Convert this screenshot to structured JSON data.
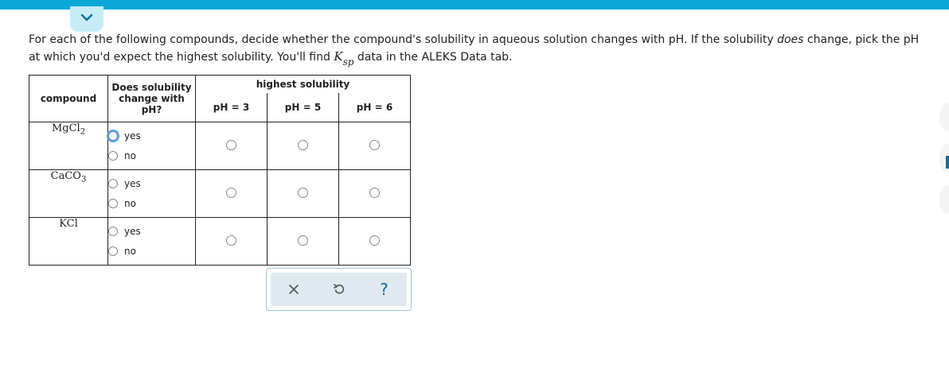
{
  "instructions": {
    "part1": "For each of the following compounds, decide whether the compound's solubility in aqueous solution changes with pH. If the solubility ",
    "emphasis": "does",
    "part2": " change, pick the pH at which you'd expect the highest solubility. You'll find ",
    "ksp_main": "K",
    "ksp_sub": "sp",
    "part3": " data in the ALEKS Data tab."
  },
  "table": {
    "header_compound": "compound",
    "header_change_line1": "Does solubility",
    "header_change_line2": "change with",
    "header_change_line3": "pH?",
    "header_highest": "highest solubility",
    "ph_columns": [
      "pH = 3",
      "pH = 5",
      "pH = 6"
    ],
    "rows": [
      {
        "formula_main": "MgCl",
        "formula_sub": "2",
        "yes": "yes",
        "no": "no"
      },
      {
        "formula_main": "CaCO",
        "formula_sub": "3",
        "yes": "yes",
        "no": "no"
      },
      {
        "formula_main": "KCl",
        "formula_sub": "",
        "yes": "yes",
        "no": "no"
      }
    ]
  },
  "toolbar": {
    "clear_icon": "x-icon",
    "undo_icon": "undo-icon",
    "help_label": "?"
  },
  "colors": {
    "accent": "#0aa8d6",
    "tab": "#c6ecf7",
    "toolbar_bg": "#dfe9ef",
    "focus": "#5a9bd5"
  }
}
